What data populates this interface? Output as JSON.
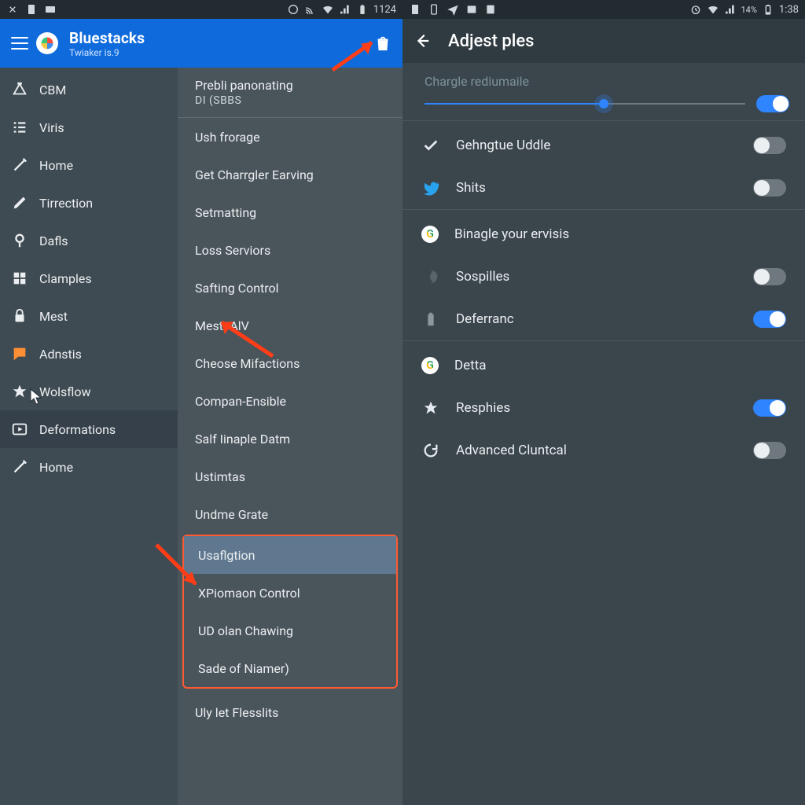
{
  "left": {
    "status": {
      "time": "1124"
    },
    "app": {
      "title": "Bluestacks",
      "subtitle": "Twiaker is.9"
    },
    "sidebar": [
      {
        "icon": "triangle",
        "label": "CBM"
      },
      {
        "icon": "list",
        "label": "Viris"
      },
      {
        "icon": "wand",
        "label": "Home"
      },
      {
        "icon": "pen",
        "label": "Tirrection"
      },
      {
        "icon": "pin",
        "label": "Dafls"
      },
      {
        "icon": "grid",
        "label": "Clamples"
      },
      {
        "icon": "lock",
        "label": "Mest"
      },
      {
        "icon": "chat",
        "label": "Adnstis",
        "orange": true
      },
      {
        "icon": "star",
        "label": "Wolsflow"
      },
      {
        "icon": "play",
        "label": "Deformations",
        "active": true
      },
      {
        "icon": "wand",
        "label": "Home"
      }
    ],
    "menu": {
      "head": {
        "h1": "Prebli panonating",
        "h2": "DI (SBBS"
      },
      "items": [
        "Ush frorage",
        "Get Charrgler Earving",
        "Setmatting",
        "Loss Serviors",
        "Safting Control",
        "Mest -AlV",
        "Cheose Mifactions",
        "Compan-Ensible",
        "Salf Iinaple Datm",
        "Ustimtas",
        "Undme Grate"
      ],
      "highlight": [
        "Usaflgtion",
        "XPiomaon Control",
        "UD olan Chawing",
        "Sade of Niamer)"
      ],
      "after": [
        "Uly let Flesslits"
      ]
    }
  },
  "right": {
    "status": {
      "battery": "14%",
      "time": "1:38"
    },
    "title": "Adjest ples",
    "slider": {
      "label": "Chargle rediumaile",
      "percent": 56
    },
    "rows": [
      {
        "icon": "check",
        "label": "Gehngtue Uddle",
        "toggle": false
      },
      {
        "icon": "twitter",
        "label": "Shits",
        "toggle": false
      },
      {
        "icon": "google",
        "label": "Binagle your ervisis",
        "toggle": null
      },
      {
        "icon": "moon",
        "label": "Sospilles",
        "toggle": false
      },
      {
        "icon": "battery",
        "label": "Deferranc",
        "toggle": true
      },
      {
        "icon": "google",
        "label": "Detta",
        "toggle": null
      },
      {
        "icon": "star",
        "label": "Resphies",
        "toggle": true
      },
      {
        "icon": "reload",
        "label": "Advanced Cluntcal",
        "toggle": false
      }
    ]
  },
  "colors": {
    "accent": "#2f84ff",
    "arrow": "#ff3d17",
    "bg": "#37474f"
  }
}
